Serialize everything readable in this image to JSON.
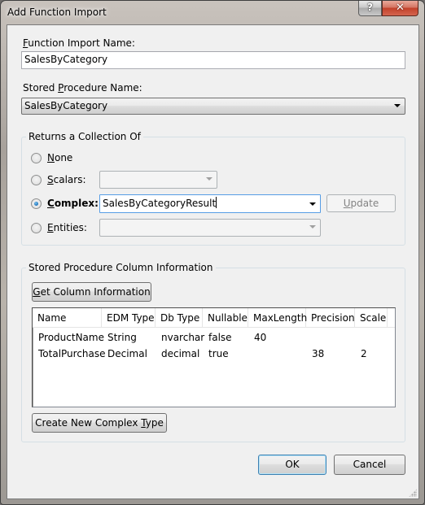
{
  "window": {
    "title": "Add Function Import",
    "help_label": "?",
    "close_label": "✕"
  },
  "function_import": {
    "label_prefix": "",
    "label_accel": "F",
    "label_rest": "unction Import Name:",
    "value": "SalesByCategory"
  },
  "stored_procedure": {
    "label_pre": "Stored ",
    "label_accel": "P",
    "label_rest": "rocedure Name:",
    "selected": "SalesByCategory"
  },
  "returns": {
    "group_title": "Returns a Collection Of",
    "selected_option": "Complex",
    "options": [
      {
        "accel": "N",
        "rest": "one",
        "checked": false
      },
      {
        "accel": "S",
        "rest": "calars:",
        "checked": false,
        "combo_value": ""
      },
      {
        "accel": "C",
        "rest": "omplex:",
        "checked": true,
        "combo_value": "SalesByCategoryResult"
      },
      {
        "accel": "E",
        "rest": "ntities:",
        "checked": false,
        "combo_value": ""
      }
    ],
    "update_button": {
      "accel": "U",
      "rest": "pdate",
      "enabled": false
    }
  },
  "column_info": {
    "group_title": "Stored Procedure Column Information",
    "get_button": {
      "accel": "G",
      "rest": "et Column Information"
    },
    "columns": [
      "Name",
      "EDM Type",
      "Db Type",
      "Nullable",
      "MaxLength",
      "Precision",
      "Scale"
    ],
    "rows": [
      [
        "ProductName",
        "String",
        "nvarchar",
        "false",
        "40",
        "",
        ""
      ],
      [
        "TotalPurchase",
        "Decimal",
        "decimal",
        "true",
        "",
        "38",
        "2"
      ]
    ],
    "create_button": {
      "pre": "Create New Complex ",
      "accel": "T",
      "rest": "ype"
    }
  },
  "footer": {
    "ok_label": "OK",
    "cancel_label": "Cancel"
  }
}
